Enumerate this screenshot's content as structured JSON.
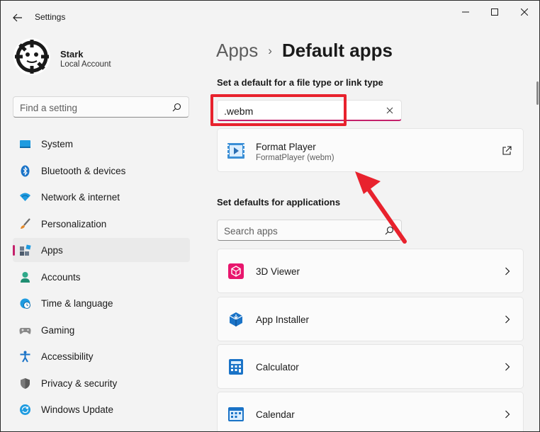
{
  "window": {
    "title": "Settings",
    "controls": [
      "minimize",
      "maximize",
      "close"
    ]
  },
  "profile": {
    "name": "Stark",
    "account_type": "Local Account"
  },
  "sidebar": {
    "search_placeholder": "Find a setting",
    "items": [
      {
        "label": "System",
        "icon": "system-icon",
        "active": false
      },
      {
        "label": "Bluetooth & devices",
        "icon": "bluetooth-icon",
        "active": false
      },
      {
        "label": "Network & internet",
        "icon": "wifi-icon",
        "active": false
      },
      {
        "label": "Personalization",
        "icon": "brush-icon",
        "active": false
      },
      {
        "label": "Apps",
        "icon": "apps-icon",
        "active": true
      },
      {
        "label": "Accounts",
        "icon": "person-icon",
        "active": false
      },
      {
        "label": "Time & language",
        "icon": "clock-globe-icon",
        "active": false
      },
      {
        "label": "Gaming",
        "icon": "gamepad-icon",
        "active": false
      },
      {
        "label": "Accessibility",
        "icon": "accessibility-icon",
        "active": false
      },
      {
        "label": "Privacy & security",
        "icon": "shield-icon",
        "active": false
      },
      {
        "label": "Windows Update",
        "icon": "update-icon",
        "active": false
      }
    ]
  },
  "main": {
    "breadcrumb": {
      "parent": "Apps",
      "separator": "›",
      "current": "Default apps"
    },
    "filetype_section_title": "Set a default for a file type or link type",
    "filetype_input_value": ".webm",
    "result": {
      "name": "Format Player",
      "detail": "FormatPlayer (webm)"
    },
    "apps_section_title": "Set defaults for applications",
    "apps_search_placeholder": "Search apps",
    "apps": [
      {
        "name": "3D Viewer",
        "icon": "3d-viewer-icon"
      },
      {
        "name": "App Installer",
        "icon": "app-installer-icon"
      },
      {
        "name": "Calculator",
        "icon": "calculator-icon"
      },
      {
        "name": "Calendar",
        "icon": "calendar-icon"
      }
    ]
  },
  "colors": {
    "accent": "#c4216b",
    "annotation_red": "#e8222d",
    "window_bg": "#f3f3f3",
    "card_bg": "#fbfbfb"
  }
}
